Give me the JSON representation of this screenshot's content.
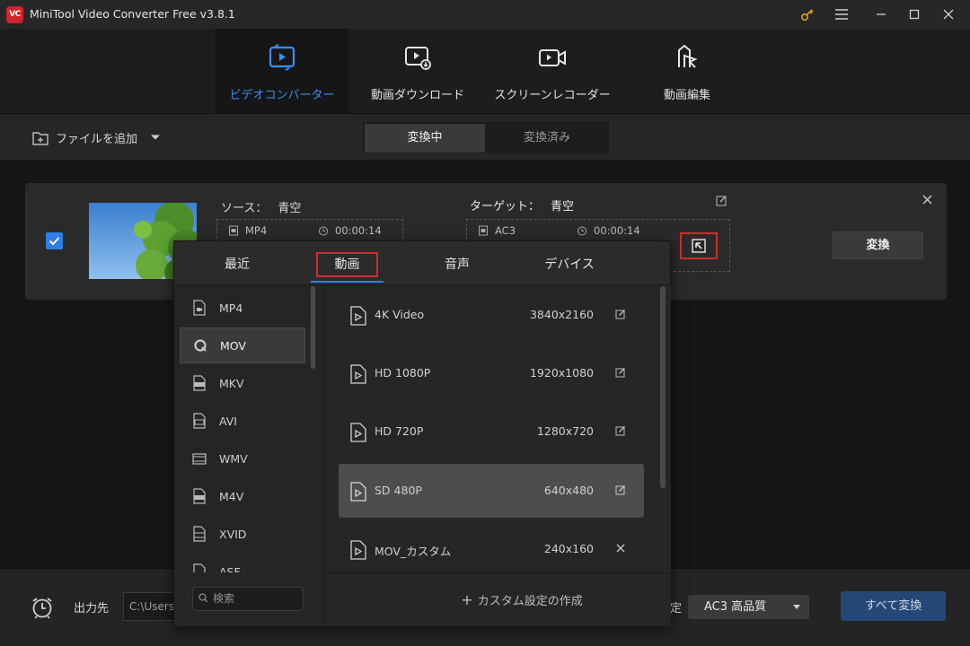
{
  "app": {
    "logo_text": "VC",
    "title": "MiniTool Video Converter Free v3.8.1"
  },
  "main_nav": [
    {
      "label": "ビデオコンバーター",
      "icon": "convert-icon",
      "active": true
    },
    {
      "label": "動画ダウンロード",
      "icon": "video-download-icon",
      "active": false
    },
    {
      "label": "スクリーンレコーダー",
      "icon": "screen-record-icon",
      "active": false
    },
    {
      "label": "動画編集",
      "icon": "video-edit-icon",
      "active": false
    }
  ],
  "toolbar": {
    "add_file": "ファイルを追加",
    "tab_converting": "変換中",
    "tab_converted": "変換済み"
  },
  "task": {
    "source_label": "ソース：",
    "source_name": "青空",
    "source_format": "MP4",
    "source_duration": "00:00:14",
    "target_label": "ターゲット：",
    "target_name": "青空",
    "target_format": "AC3",
    "target_duration": "00:00:14",
    "convert_button": "変換"
  },
  "popup": {
    "tabs": [
      "最近",
      "動画",
      "音声",
      "デバイス"
    ],
    "active_tab": "動画",
    "formats": [
      "MP4",
      "MOV",
      "MKV",
      "AVI",
      "WMV",
      "M4V",
      "XVID",
      "ASF"
    ],
    "selected_format": "MOV",
    "search_placeholder": "検索",
    "presets": [
      {
        "name": "4K Video",
        "resolution": "3840x2160",
        "action": "edit"
      },
      {
        "name": "HD 1080P",
        "resolution": "1920x1080",
        "action": "edit"
      },
      {
        "name": "HD 720P",
        "resolution": "1280x720",
        "action": "edit"
      },
      {
        "name": "SD 480P",
        "resolution": "640x480",
        "action": "edit"
      },
      {
        "name": "MOV_カスタム",
        "resolution": "240x160",
        "action": "delete"
      }
    ],
    "selected_preset": "SD 480P",
    "custom_create": "カスタム設定の作成"
  },
  "bottom": {
    "output_label": "出力先",
    "output_path": "C:\\Users",
    "format_label_fragment": "定",
    "format_select": "AC3 高品質",
    "convert_all": "すべて変換"
  },
  "colors": {
    "accent_blue": "#3d8ef0",
    "highlight_red": "#d42b2b",
    "logo_red": "#d3232a",
    "convert_all_bg": "#264878"
  }
}
